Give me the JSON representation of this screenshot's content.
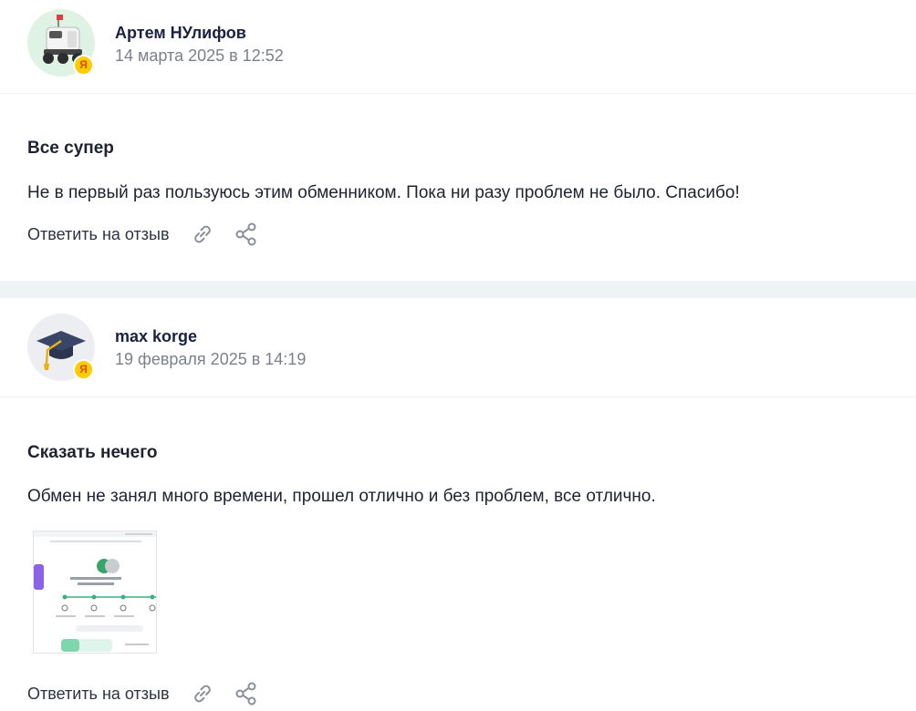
{
  "reviews": [
    {
      "author": "Артем НУлифов",
      "date": "14 марта 2025 в 12:52",
      "title": "Все супер",
      "text": "Не в первый раз пользуюсь этим обменником. Пока ни разу проблем не было. Спасибо!",
      "avatar_badge": "Я",
      "avatar_icon": "delivery-robot-icon",
      "reply_label": "Ответить на отзыв"
    },
    {
      "author": "max korge",
      "date": "19 февраля 2025 в 14:19",
      "title": "Сказать нечего",
      "text": "Обмен не занял много времени, прошел отлично и без проблем, все отлично.",
      "avatar_badge": "Я",
      "avatar_icon": "graduation-cap-icon",
      "reply_label": "Ответить на отзыв",
      "attachment": "screenshot-thumbnail"
    }
  ],
  "colors": {
    "author": "#1a2240",
    "date": "#7b808a",
    "separator": "#eef3f4",
    "badge": "#ffcc00",
    "icon": "#8a9099"
  }
}
